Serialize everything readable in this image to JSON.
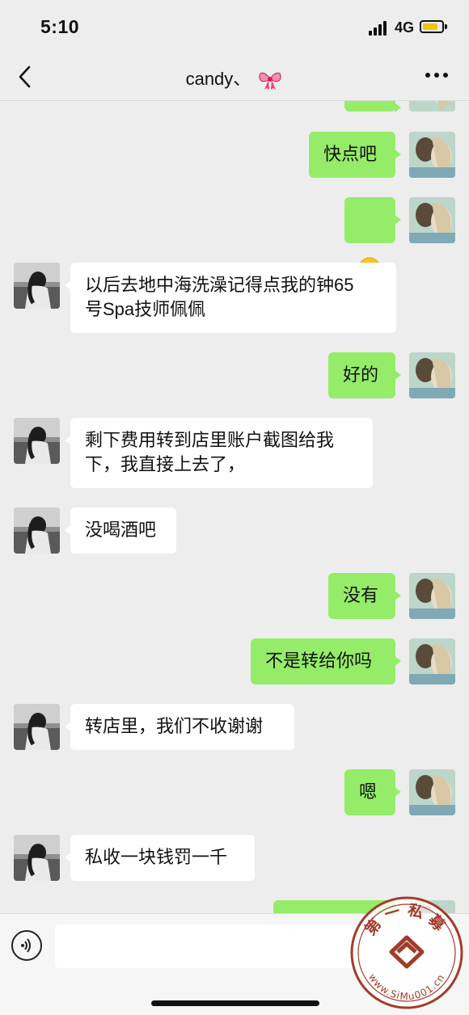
{
  "status": {
    "time": "5:10",
    "network": "4G",
    "battery_color": "#f3c300"
  },
  "nav": {
    "title": "candy、",
    "back_icon": "chevron-left-icon",
    "more_icon": "more-dots-icon",
    "title_emoji": "ribbon-bow-icon"
  },
  "colors": {
    "outgoing": "#95ec69",
    "incoming": "#ffffff",
    "background": "#ededed"
  },
  "messages": [
    {
      "side": "out",
      "text": "快点吧"
    },
    {
      "side": "out",
      "emoji": "winking-tongue-emoji"
    },
    {
      "side": "in",
      "text": "以后去地中海洗澡记得点我的钟65\n号Spa技师佩佩"
    },
    {
      "side": "out",
      "text": "好的"
    },
    {
      "side": "in",
      "text": "剩下费用转到店里账户截图给我\n下，我直接上去了，"
    },
    {
      "side": "in",
      "text": "没喝酒吧"
    },
    {
      "side": "out",
      "text": "没有"
    },
    {
      "side": "out",
      "text": "不是转给你吗"
    },
    {
      "side": "in",
      "text": "转店里，我们不收谢谢"
    },
    {
      "side": "out",
      "text": "嗯"
    },
    {
      "side": "in",
      "text": "私收一块钱罚一千"
    }
  ],
  "input": {
    "voice_icon": "voice-icon",
    "value": ""
  },
  "watermark": {
    "text": "第一私募",
    "url": "www.SiMu001.cn"
  }
}
